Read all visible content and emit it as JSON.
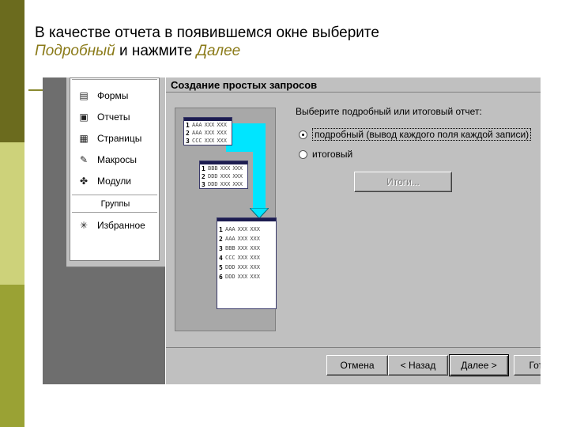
{
  "slide": {
    "title_part1": "В качестве отчета в  появившемся окне выберите",
    "title_hl1": "Подробный",
    "title_mid": " и нажмите ",
    "title_hl2": "Далее",
    "colors": {
      "bar_dark": "#6b6b1e",
      "bar_light": "#cdd27a",
      "bar_mid": "#9aa234",
      "highlight_text": "#8a7a18"
    }
  },
  "objects_panel": {
    "items": [
      {
        "label": "Формы",
        "icon": "form-icon"
      },
      {
        "label": "Отчеты",
        "icon": "report-icon"
      },
      {
        "label": "Страницы",
        "icon": "page-icon"
      },
      {
        "label": "Макросы",
        "icon": "macro-icon"
      },
      {
        "label": "Модули",
        "icon": "module-icon"
      }
    ],
    "groups_label": "Группы",
    "favorites_label": "Избранное"
  },
  "wizard": {
    "title": "Создание простых запросов",
    "prompt": "Выберите подробный или итоговый отчет:",
    "option_detail": "подробный (вывод каждого поля каждой записи)",
    "option_summary": "итоговый",
    "selected": "detail",
    "totals_button": "Итоги...",
    "buttons": {
      "cancel": "Отмена",
      "back": "< Назад",
      "next": "Далее >",
      "finish": "Готово"
    },
    "illustration": {
      "table1": [
        {
          "n": "1",
          "c1": "AAA",
          "c2": "XXX",
          "c3": "XXX"
        },
        {
          "n": "2",
          "c1": "AAA",
          "c2": "XXX",
          "c3": "XXX"
        },
        {
          "n": "3",
          "c1": "CCC",
          "c2": "XXX",
          "c3": "XXX"
        }
      ],
      "table2": [
        {
          "n": "1",
          "c1": "BBB",
          "c2": "XXX",
          "c3": "XXX"
        },
        {
          "n": "2",
          "c1": "DDD",
          "c2": "XXX",
          "c3": "XXX"
        },
        {
          "n": "3",
          "c1": "DDD",
          "c2": "XXX",
          "c3": "XXX"
        }
      ],
      "table3": [
        {
          "n": "1",
          "c1": "AAA",
          "c2": "XXX",
          "c3": "XXX"
        },
        {
          "n": "2",
          "c1": "AAA",
          "c2": "XXX",
          "c3": "XXX"
        },
        {
          "n": "3",
          "c1": "BBB",
          "c2": "XXX",
          "c3": "XXX"
        },
        {
          "n": "4",
          "c1": "CCC",
          "c2": "XXX",
          "c3": "XXX"
        },
        {
          "n": "5",
          "c1": "DDD",
          "c2": "XXX",
          "c3": "XXX"
        },
        {
          "n": "6",
          "c1": "DDD",
          "c2": "XXX",
          "c3": "XXX"
        }
      ]
    }
  }
}
